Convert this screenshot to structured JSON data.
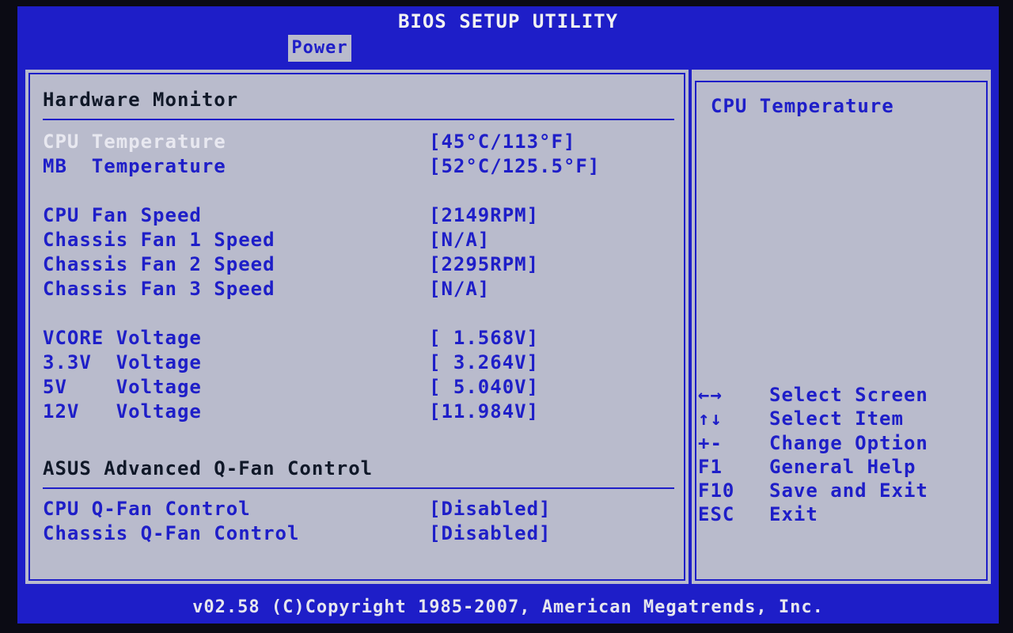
{
  "title": "BIOS SETUP UTILITY",
  "tabs": [
    {
      "label": "Power",
      "active": true
    }
  ],
  "main": {
    "section_title": "Hardware Monitor",
    "items": [
      {
        "label": "CPU Temperature",
        "value": "[45°C/113°F]"
      },
      {
        "label": "MB  Temperature",
        "value": "[52°C/125.5°F]"
      },
      {
        "label": "CPU Fan Speed",
        "value": "[2149RPM]"
      },
      {
        "label": "Chassis Fan 1 Speed",
        "value": "[N/A]"
      },
      {
        "label": "Chassis Fan 2 Speed",
        "value": "[2295RPM]"
      },
      {
        "label": "Chassis Fan 3 Speed",
        "value": "[N/A]"
      },
      {
        "label": "VCORE Voltage",
        "value": "[ 1.568V]"
      },
      {
        "label": "3.3V  Voltage",
        "value": "[ 3.264V]"
      },
      {
        "label": "5V    Voltage",
        "value": "[ 5.040V]"
      },
      {
        "label": "12V   Voltage",
        "value": "[11.984V]"
      }
    ],
    "subsection_title": "ASUS Advanced Q-Fan Control",
    "qfan_items": [
      {
        "label": "CPU Q-Fan Control",
        "value": "[Disabled]"
      },
      {
        "label": "Chassis Q-Fan Control",
        "value": "[Disabled]"
      }
    ]
  },
  "help": {
    "title": "CPU Temperature",
    "keys": [
      {
        "key": "←→",
        "desc": "Select Screen"
      },
      {
        "key": "↑↓",
        "desc": "Select Item"
      },
      {
        "key": "+-",
        "desc": "Change Option"
      },
      {
        "key": "F1",
        "desc": "General Help"
      },
      {
        "key": "F10",
        "desc": "Save and Exit"
      },
      {
        "key": "ESC",
        "desc": "Exit"
      }
    ]
  },
  "footer": "v02.58 (C)Copyright 1985-2007, American Megatrends, Inc.",
  "colors": {
    "background_blue": "#1e1ec8",
    "panel_gray": "#b9bbcc",
    "selected_text": "#e8e8f0"
  }
}
